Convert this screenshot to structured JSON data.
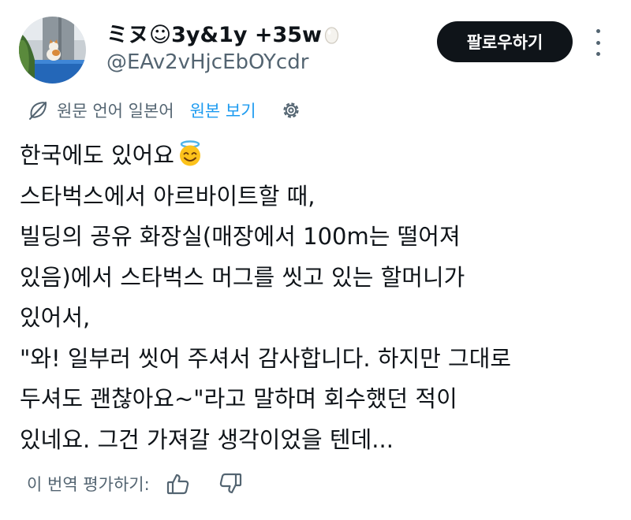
{
  "tweet": {
    "author": {
      "display_name": "ミヌ☺3y&1y +35w",
      "emoji_icon": "egg-icon",
      "handle": "@EAv2vHjcEbOYcdr",
      "avatar_icon": "cat-photo-avatar"
    },
    "follow_button_label": "팔로우하기",
    "more_icon": "more-vertical-icon",
    "translation": {
      "icon": "translate-icon",
      "source_language_note": "원문 언어 일본어",
      "show_original_label": "원본 보기",
      "settings_icon": "gear-icon"
    },
    "body_lines": [
      "한국에도 있어요",
      "스타벅스에서 아르바이트할 때,",
      "빌딩의 공유 화장실(매장에서 100m는 떨어져",
      "있음)에서 스타벅스 머그를 씻고 있는 할머니가",
      "있어서,",
      "\"와! 일부러 씻어 주셔서 감사합니다. 하지만 그대로",
      "두셔도 괜찮아요~\"라고 말하며 회수했던 적이",
      "있네요. 그건 가져갈 생각이었을 텐데..."
    ],
    "body_emoji": "smiling-face-with-halo-emoji",
    "rating": {
      "label": "이 번역 평가하기:",
      "thumbs_up_icon": "thumbs-up-icon",
      "thumbs_down_icon": "thumbs-down-icon"
    }
  },
  "colors": {
    "text_primary": "#0f1419",
    "text_secondary": "#536471",
    "link": "#1d9bf0",
    "button_bg": "#0f1419",
    "button_text": "#ffffff"
  }
}
